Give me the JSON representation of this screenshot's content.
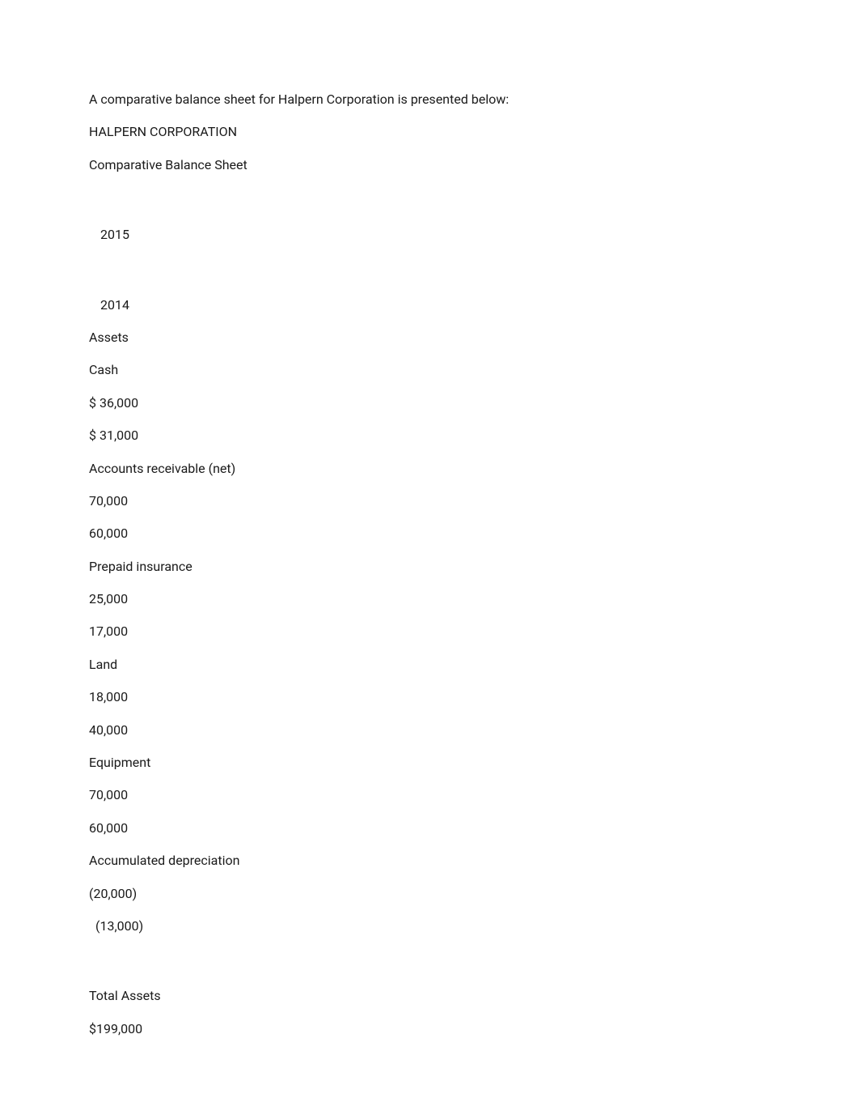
{
  "intro": "A comparative balance sheet for Halpern Corporation is presented below:",
  "company": "HALPERN CORPORATION",
  "title": "Comparative Balance Sheet",
  "years": {
    "y1": "2015",
    "y2": "2014"
  },
  "sections": {
    "assets_header": "Assets",
    "cash": {
      "label": "Cash",
      "v2015": "$ 36,000",
      "v2014": "$ 31,000"
    },
    "ar": {
      "label": "Accounts receivable (net)",
      "v2015": "70,000",
      "v2014": "60,000"
    },
    "prepaid": {
      "label": "Prepaid insurance",
      "v2015": "25,000",
      "v2014": "17,000"
    },
    "land": {
      "label": "Land",
      "v2015": "18,000",
      "v2014": "40,000"
    },
    "equipment": {
      "label": "Equipment",
      "v2015": "70,000",
      "v2014": "60,000"
    },
    "accdep": {
      "label": "Accumulated depreciation",
      "v2015": "(20,000)",
      "v2014": "(13,000)"
    },
    "total_assets": {
      "label": "Total Assets",
      "v2015": "$199,000"
    }
  }
}
